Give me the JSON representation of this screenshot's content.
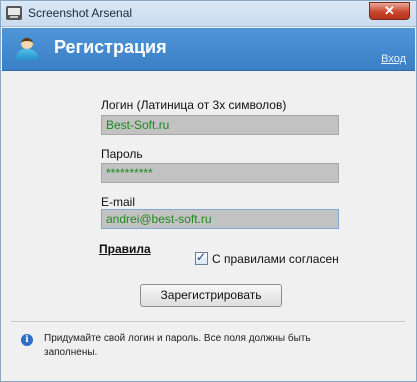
{
  "window": {
    "title": "Screenshot Arsenal",
    "close_label": "✕"
  },
  "banner": {
    "title": "Регистрация",
    "logout_link": "Вход"
  },
  "form": {
    "login": {
      "label": "Логин (Латиница от 3х символов)",
      "value": "Best-Soft.ru"
    },
    "password": {
      "label": "Пароль",
      "value": "**********"
    },
    "email": {
      "label": "E-mail",
      "value": "andrei@best-soft.ru"
    },
    "rules_link": "Правила",
    "agree": {
      "label": "С правилами согласен",
      "checked": true,
      "mark": "✓"
    },
    "submit_label": "Зарегистрировать"
  },
  "info": {
    "icon": "i",
    "text": "Придумайте свой логин и пароль. Все поля должны быть заполнены."
  }
}
